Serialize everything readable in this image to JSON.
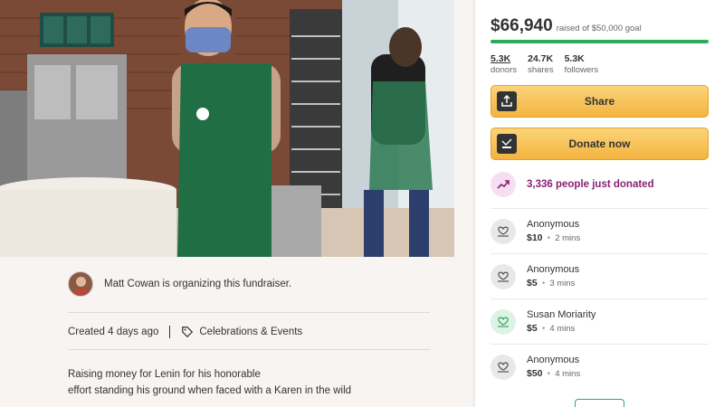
{
  "fundraiser": {
    "organizer_text": "Matt Cowan is organizing this fundraiser.",
    "created": "Created 4 days ago",
    "category": "Celebrations & Events",
    "story_line1": "Raising money for Lenin for his honorable",
    "story_line2": "effort standing his ground when faced with a Karen in the wild"
  },
  "summary": {
    "amount": "$66,940",
    "goal_text": "raised of $50,000 goal",
    "progress_fraction": 1.0,
    "stats": [
      {
        "num": "5.3K",
        "label": "donors"
      },
      {
        "num": "24.7K",
        "label": "shares"
      },
      {
        "num": "5.3K",
        "label": "followers"
      }
    ]
  },
  "buttons": {
    "share": "Share",
    "donate": "Donate now"
  },
  "trend": {
    "text": "3,336 people just donated"
  },
  "donations": [
    {
      "name": "Anonymous",
      "amount": "$10",
      "time": "2 mins"
    },
    {
      "name": "Anonymous",
      "amount": "$5",
      "time": "3 mins"
    },
    {
      "name": "Susan Moriarity",
      "amount": "$5",
      "time": "4 mins"
    },
    {
      "name": "Anonymous",
      "amount": "$50",
      "time": "4 mins"
    }
  ],
  "colors": {
    "progress": "#2eaa5c",
    "button": "#f3b43f",
    "trend_text": "#8a1f74"
  },
  "icons": {
    "share": "share-upload-icon",
    "donate": "donate-money-icon",
    "trend": "trending-up-icon",
    "donor": "heart-hand-icon",
    "category": "tag-icon"
  }
}
